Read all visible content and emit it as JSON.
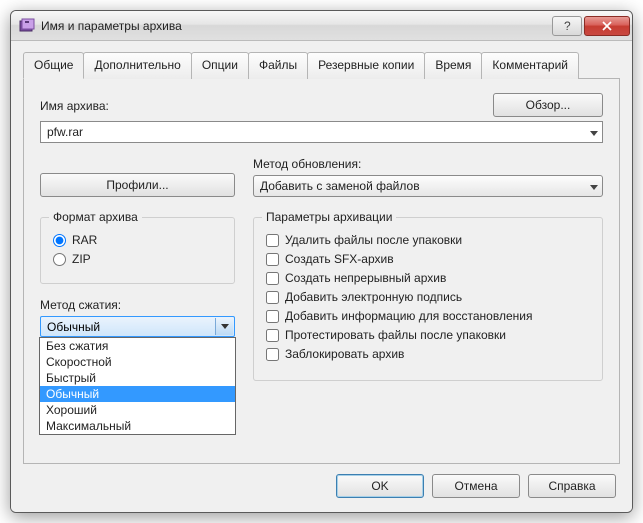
{
  "window": {
    "title": "Имя и параметры архива"
  },
  "tabs": {
    "general": "Общие",
    "advanced": "Дополнительно",
    "options": "Опции",
    "files": "Файлы",
    "backup": "Резервные копии",
    "time": "Время",
    "comment": "Комментарий"
  },
  "archive_name": {
    "label": "Имя архива:",
    "value": "pfw.rar",
    "browse": "Обзор..."
  },
  "profiles_btn": "Профили...",
  "update_method": {
    "label": "Метод обновления:",
    "value": "Добавить с заменой файлов"
  },
  "format": {
    "legend": "Формат архива",
    "rar": "RAR",
    "zip": "ZIP",
    "selected": "rar"
  },
  "compression": {
    "label": "Метод сжатия:",
    "value": "Обычный",
    "options": [
      "Без сжатия",
      "Скоростной",
      "Быстрый",
      "Обычный",
      "Хороший",
      "Максимальный"
    ],
    "selected_index": 3
  },
  "arch_params": {
    "legend": "Параметры архивации",
    "delete_after": "Удалить файлы после упаковки",
    "sfx": "Создать SFX-архив",
    "solid": "Создать непрерывный архив",
    "sign": "Добавить электронную подпись",
    "recovery": "Добавить информацию для восстановления",
    "test": "Протестировать файлы после упаковки",
    "lock": "Заблокировать архив"
  },
  "buttons": {
    "ok": "OK",
    "cancel": "Отмена",
    "help": "Справка"
  }
}
